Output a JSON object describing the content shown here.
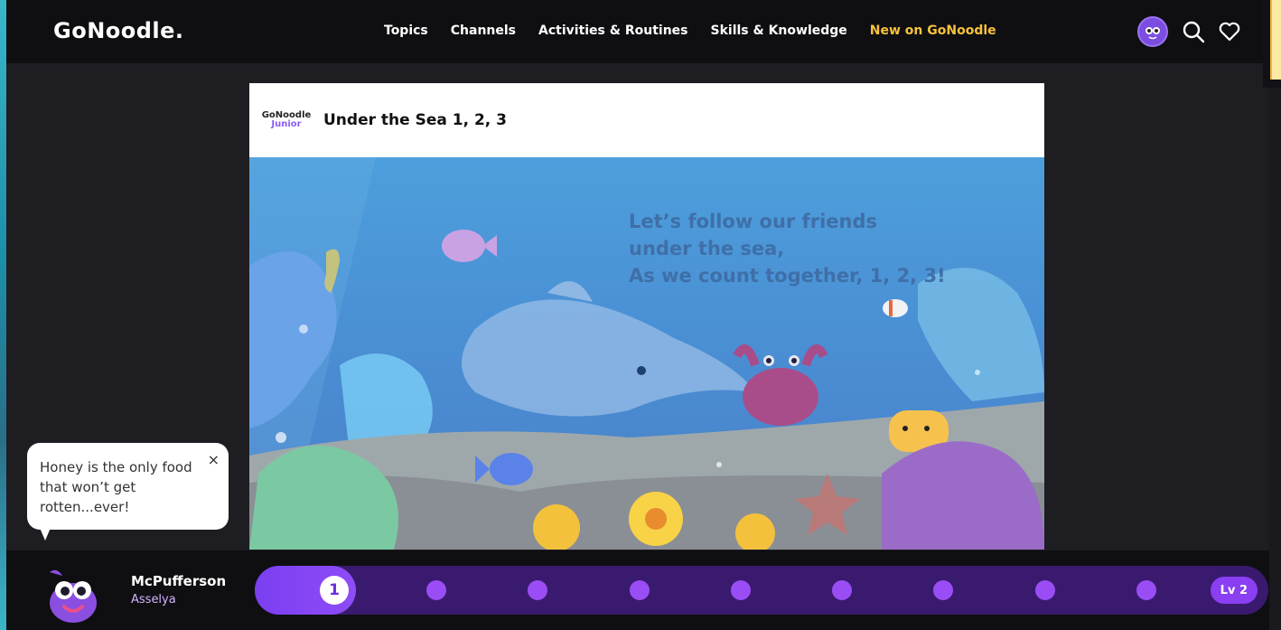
{
  "header": {
    "logo": "GoNoodle.",
    "nav": [
      {
        "label": "Topics"
      },
      {
        "label": "Channels"
      },
      {
        "label": "Activities & Routines"
      },
      {
        "label": "Skills & Knowledge"
      },
      {
        "label": "New on GoNoodle"
      }
    ]
  },
  "video": {
    "brand_line1": "GoNoodle",
    "brand_line2": "Junior",
    "title": "Under the Sea 1, 2, 3",
    "lyrics": [
      "Let’s follow our friends",
      "under the sea,",
      "As we count together, 1, 2, 3!"
    ]
  },
  "fun_fact": {
    "text": "Honey is the only food that won’t get rotten...ever!",
    "close": "×"
  },
  "player": {
    "champ_name": "McPufferson",
    "user_name": "Asselya",
    "current_step": "1",
    "level": "Lv 2",
    "remaining_steps": 8
  },
  "colors": {
    "accent": "#8a3ff2",
    "highlight": "#f8c23b",
    "bg": "#0f0f12"
  },
  "icons": [
    "avatar-icon",
    "search-icon",
    "heart-icon",
    "close-icon"
  ]
}
